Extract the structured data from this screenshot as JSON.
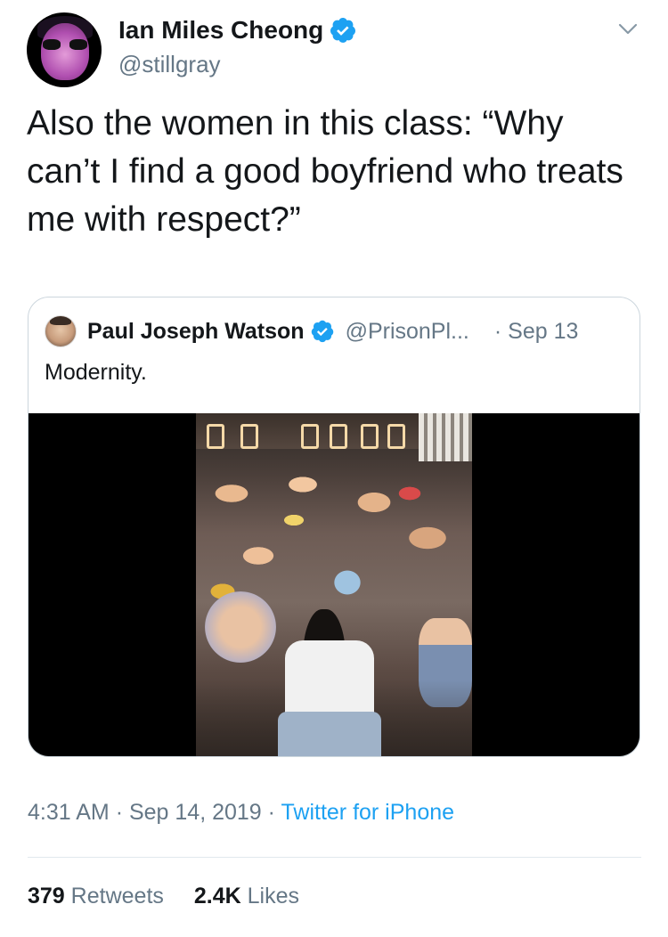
{
  "author": {
    "name": "Ian Miles Cheong",
    "handle": "@stillgray",
    "verified": true
  },
  "tweet": {
    "text": "Also the women in this class: “Why can’t I find a good boyfriend who treats me with respect?”",
    "time": "4:31 AM",
    "date": "Sep 14, 2019",
    "source": "Twitter for iPhone",
    "separator": "·"
  },
  "quote": {
    "name": "Paul Joseph Watson",
    "handle": "@PrisonPl...",
    "date": "· Sep 13",
    "text": "Modernity.",
    "media_type": "video"
  },
  "stats": {
    "retweets_count": "379",
    "retweets_label": "Retweets",
    "likes_count": "2.4K",
    "likes_label": "Likes"
  },
  "icons": {
    "verified": "verified-badge-icon",
    "caret": "chevron-down-icon"
  },
  "colors": {
    "link": "#1da1f2",
    "secondary_text": "#657786",
    "primary_text": "#14171a",
    "border": "#ccd6dd"
  }
}
